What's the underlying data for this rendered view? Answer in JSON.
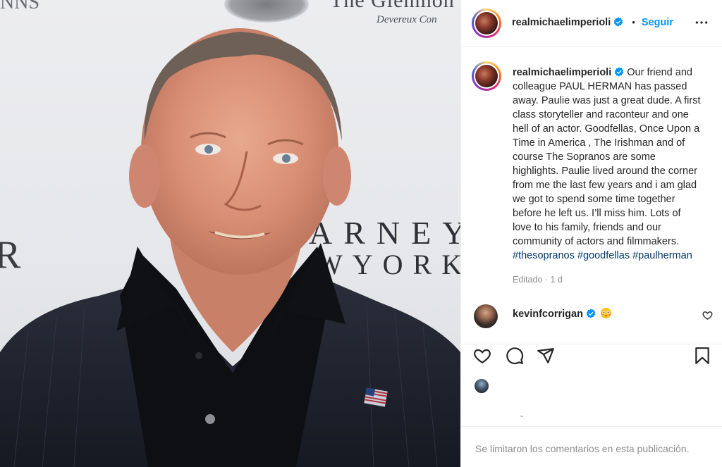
{
  "photo": {
    "backdrop_texts": [
      "The Glenmon",
      "Devereux Con",
      "NNS",
      "ARNEY",
      "WYORK",
      "R"
    ]
  },
  "post": {
    "author": "realmichaelimperioli",
    "follow_label": "Seguir",
    "dot": "•",
    "caption_lines": [
      "Our friend and",
      "colleague PAUL HERMAN has passed",
      "away. Paulie was just a great dude. A first",
      "class storyteller and raconteur and one",
      "hell of an actor. Goodfellas, Once Upon a",
      "Time in America , The Irishman and of",
      "course The Sopranos are some",
      "highlights. Paulie lived around the corner",
      "from me the last few years and i am glad",
      "we got to spend some time together",
      "before he left us. I’ll miss him. Lots of",
      "love to his family, friends and our",
      "community of actors and filmmakers."
    ],
    "hashtags": [
      "#thesopranos",
      "#goodfellas",
      "#paulherman"
    ],
    "meta": "Editado · 1 d"
  },
  "comment": {
    "author": "kevinfcorrigan",
    "emoji_icon": "flushed-face-emoji"
  },
  "footer": {
    "text": "Se limitaron los comentarios en esta publicación."
  },
  "colors": {
    "accent_blue": "#0095f6",
    "hashtag": "#00376b",
    "muted": "#8e8e8e",
    "text": "#262626"
  }
}
